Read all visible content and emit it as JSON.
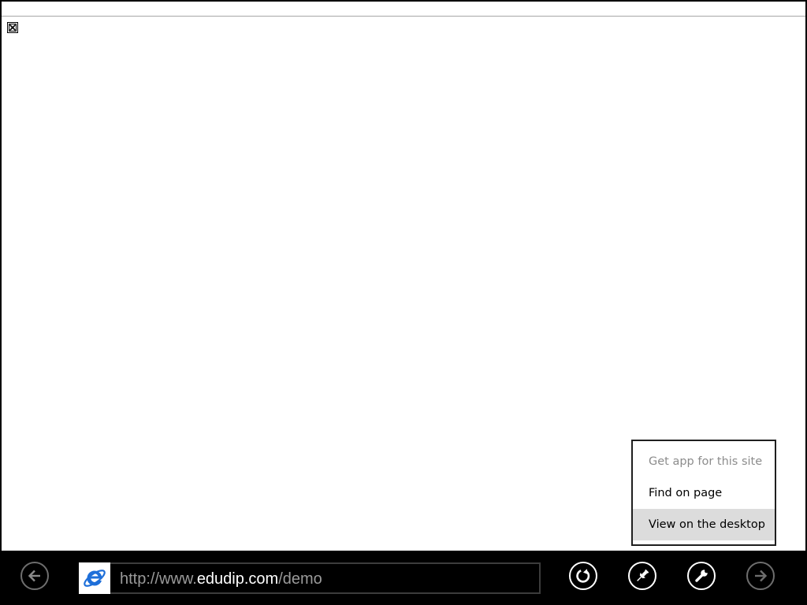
{
  "page_tools_menu": {
    "items": [
      {
        "label": "Get app for this site",
        "state": "disabled"
      },
      {
        "label": "Find on page",
        "state": "normal"
      },
      {
        "label": "View on the desktop",
        "state": "highlighted"
      }
    ]
  },
  "address_bar": {
    "url_scheme_prefix": "http://www.",
    "url_domain": "edudip.com",
    "url_path": "/demo",
    "favicon": "internet-explorer-icon"
  },
  "app_bar": {
    "buttons": [
      {
        "icon": "back-arrow-icon",
        "state": "enabled"
      },
      {
        "icon": "refresh-icon",
        "state": "enabled"
      },
      {
        "icon": "pin-icon",
        "state": "enabled"
      },
      {
        "icon": "wrench-icon",
        "state": "enabled"
      },
      {
        "icon": "forward-arrow-icon",
        "state": "disabled"
      }
    ]
  },
  "page_content": {
    "broken_image_icon": "broken-image-icon"
  },
  "colors": {
    "app_bar_background": "#000000",
    "menu_highlight": "#dcdcdc",
    "disabled_text": "#8c8c8c",
    "ie_blue": "#1e6fd9"
  }
}
